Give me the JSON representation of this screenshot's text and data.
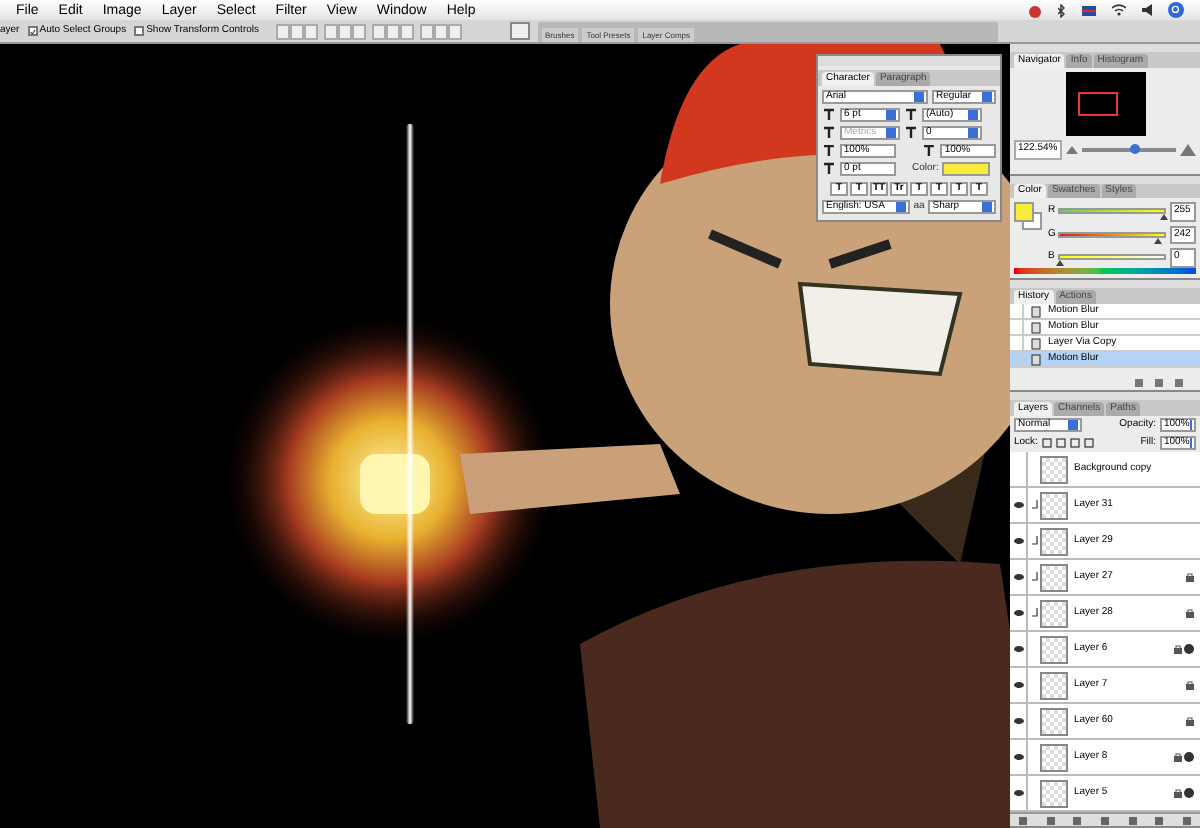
{
  "menu": [
    "File",
    "Edit",
    "Image",
    "Layer",
    "Select",
    "Filter",
    "View",
    "Window",
    "Help"
  ],
  "options_bar": {
    "label": "ayer",
    "checkboxes": [
      {
        "label": "Auto Select Groups",
        "checked": true
      },
      {
        "label": "Show Transform Controls",
        "checked": false
      }
    ]
  },
  "palette_well": {
    "tabs": [
      "Brushes",
      "Tool Presets",
      "Layer Comps"
    ]
  },
  "character": {
    "tabs": [
      {
        "label": "Character",
        "selected": true
      },
      {
        "label": "Paragraph",
        "selected": false
      }
    ],
    "font": "Arial",
    "style": "Regular",
    "size": "6 pt",
    "leading": "(Auto)",
    "kerning": "Metrics",
    "tracking": "0",
    "vertical_scale": "100%",
    "horizontal_scale": "100%",
    "baseline_shift": "0 pt",
    "color_label": "Color:",
    "color": "#f8ec3a",
    "style_buttons": [
      "T",
      "T",
      "TT",
      "Tr",
      "T",
      "T",
      "T",
      "T"
    ],
    "language": "English: USA",
    "aa_label": "aa",
    "antialias": "Sharp"
  },
  "navigator": {
    "tabs": [
      {
        "label": "Navigator",
        "selected": true
      },
      {
        "label": "Info",
        "selected": false
      },
      {
        "label": "Histogram",
        "selected": false
      }
    ],
    "zoom": "122.54%",
    "level": 0.55
  },
  "color": {
    "tabs": [
      {
        "label": "Color",
        "selected": true
      },
      {
        "label": "Swatches",
        "selected": false
      },
      {
        "label": "Styles",
        "selected": false
      }
    ],
    "channels": [
      {
        "name": "R",
        "value": "255",
        "level": 1.0
      },
      {
        "name": "G",
        "value": "242",
        "level": 0.95
      },
      {
        "name": "B",
        "value": "0",
        "level": 0.0
      }
    ]
  },
  "history": {
    "tabs": [
      {
        "label": "History",
        "selected": true
      },
      {
        "label": "Actions",
        "selected": false
      }
    ],
    "items": [
      {
        "label": "Motion Blur",
        "selected": false
      },
      {
        "label": "Motion Blur",
        "selected": false
      },
      {
        "label": "Layer Via Copy",
        "selected": false
      },
      {
        "label": "Motion Blur",
        "selected": true
      }
    ]
  },
  "layers": {
    "tabs": [
      {
        "label": "Layers",
        "selected": true
      },
      {
        "label": "Channels",
        "selected": false
      },
      {
        "label": "Paths",
        "selected": false
      }
    ],
    "blend_mode": "Normal",
    "opacity_label": "Opacity:",
    "opacity": "100%",
    "lock_label": "Lock:",
    "fill_label": "Fill:",
    "fill": "100%",
    "items": [
      {
        "name": "Background copy",
        "visible": false,
        "clipped": false,
        "locked": false,
        "fx": false
      },
      {
        "name": "Layer 31",
        "visible": true,
        "clipped": true,
        "locked": false,
        "fx": false
      },
      {
        "name": "Layer 29",
        "visible": true,
        "clipped": true,
        "locked": false,
        "fx": false
      },
      {
        "name": "Layer 27",
        "visible": true,
        "clipped": true,
        "locked": true,
        "fx": false
      },
      {
        "name": "Layer 28",
        "visible": true,
        "clipped": true,
        "locked": true,
        "fx": false
      },
      {
        "name": "Layer 6",
        "visible": true,
        "clipped": false,
        "locked": true,
        "fx": true
      },
      {
        "name": "Layer 7",
        "visible": true,
        "clipped": false,
        "locked": true,
        "fx": false
      },
      {
        "name": "Layer 60",
        "visible": true,
        "clipped": false,
        "locked": true,
        "fx": false
      },
      {
        "name": "Layer 8",
        "visible": true,
        "clipped": false,
        "locked": true,
        "fx": true
      },
      {
        "name": "Layer 5",
        "visible": true,
        "clipped": false,
        "locked": true,
        "fx": true
      }
    ]
  }
}
